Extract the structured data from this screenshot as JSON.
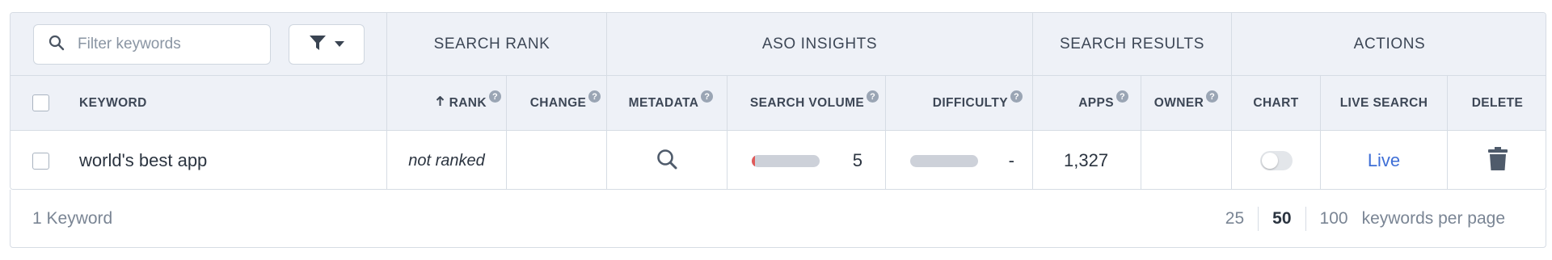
{
  "filter": {
    "placeholder": "Filter keywords",
    "search_icon": "search-icon",
    "filter_icon": "funnel-icon",
    "caret_icon": "caret-down-icon"
  },
  "groups": {
    "search_rank": "SEARCH RANK",
    "aso_insights": "ASO INSIGHTS",
    "search_results": "SEARCH RESULTS",
    "actions": "ACTIONS"
  },
  "columns": {
    "keyword": "KEYWORD",
    "rank": "RANK",
    "rank_sort_icon": "arrow-up-icon",
    "change": "CHANGE",
    "metadata": "METADATA",
    "search_volume": "SEARCH VOLUME",
    "difficulty": "DIFFICULTY",
    "apps": "APPS",
    "owner": "OWNER",
    "chart": "CHART",
    "live_search": "LIVE SEARCH",
    "delete": "DELETE",
    "help_glyph": "?"
  },
  "rows": [
    {
      "keyword": "world's best app",
      "rank": "not ranked",
      "change": "",
      "metadata_icon": "magnifier-icon",
      "search_volume": "5",
      "search_volume_fraction": 0.05,
      "difficulty": "-",
      "difficulty_fraction": 0,
      "apps": "1,327",
      "owner": "",
      "chart_toggle": false,
      "live_search": "Live",
      "delete_icon": "trash-icon"
    }
  ],
  "footer": {
    "count_label": "1 Keyword",
    "page_sizes": [
      "25",
      "50",
      "100"
    ],
    "active_page_size": "50",
    "per_page_label": "keywords per page"
  },
  "colors": {
    "header_bg": "#eef1f7",
    "border": "#d6dce4",
    "link": "#3f6fd6",
    "volume_bar_fill": "#e05a5a",
    "bar_track": "#cdd1d9"
  }
}
